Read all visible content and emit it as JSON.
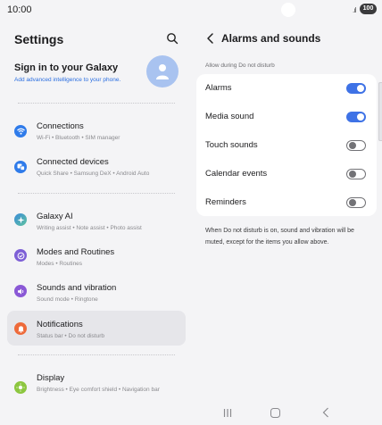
{
  "status": {
    "time": "10:00",
    "signal": ".ıl",
    "battery": "100"
  },
  "left": {
    "title": "Settings",
    "account": {
      "title": "Sign in to your Galaxy",
      "subtitle": "Add advanced intelligence to your phone."
    },
    "items": [
      {
        "name": "Connections",
        "sub": "Wi-Fi  •  Bluetooth  •  SIM manager",
        "icon": "wifi-icon",
        "color": "#2f7bea"
      },
      {
        "name": "Connected devices",
        "sub": "Quick Share  •  Samsung DeX  •  Android Auto",
        "icon": "devices-icon",
        "color": "#2f7bea"
      },
      {
        "name": "Galaxy AI",
        "sub": "Writing assist  •  Note assist  •  Photo assist",
        "icon": "sparkle-icon",
        "color": "#3a8bd8"
      },
      {
        "name": "Modes and Routines",
        "sub": "Modes  •  Routines",
        "icon": "check-circle-icon",
        "color": "#7d5fd6"
      },
      {
        "name": "Sounds and vibration",
        "sub": "Sound mode  •  Ringtone",
        "icon": "speaker-icon",
        "color": "#8a58d6"
      },
      {
        "name": "Notifications",
        "sub": "Status bar  •  Do not disturb",
        "icon": "bell-icon",
        "color": "#ee6a3a"
      },
      {
        "name": "Display",
        "sub": "Brightness  •  Eye comfort shield  •  Navigation bar",
        "icon": "sun-icon",
        "color": "#8cc63f"
      }
    ]
  },
  "right": {
    "title": "Alarms and sounds",
    "section_label": "Allow during Do not disturb",
    "rows": [
      {
        "label": "Alarms",
        "on": true
      },
      {
        "label": "Media sound",
        "on": true
      },
      {
        "label": "Touch sounds",
        "on": false
      },
      {
        "label": "Calendar events",
        "on": false
      },
      {
        "label": "Reminders",
        "on": false
      }
    ],
    "note": "When Do not disturb is on, sound and vibration will be muted, except for the items you allow above."
  },
  "colors": {
    "accent": "#3e72e6",
    "background": "#f4f4f6",
    "card": "#ffffff"
  }
}
